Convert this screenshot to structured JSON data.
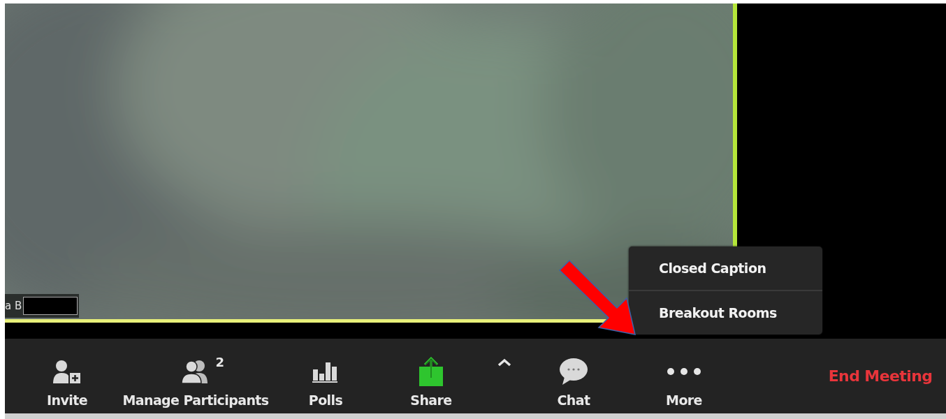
{
  "video": {
    "name_tag": "a B"
  },
  "menu": {
    "items": [
      {
        "label": "Closed Caption"
      },
      {
        "label": "Breakout Rooms"
      }
    ]
  },
  "toolbar": {
    "items": [
      {
        "kind": "invite",
        "label": "Invite"
      },
      {
        "kind": "participants",
        "label": "Manage Participants",
        "count": "2"
      },
      {
        "kind": "polls",
        "label": "Polls"
      },
      {
        "kind": "share",
        "label": "Share"
      },
      {
        "kind": "caret"
      },
      {
        "kind": "chat",
        "label": "Chat"
      },
      {
        "kind": "more",
        "label": "More"
      },
      {
        "kind": "end",
        "label": "End Meeting"
      }
    ]
  }
}
